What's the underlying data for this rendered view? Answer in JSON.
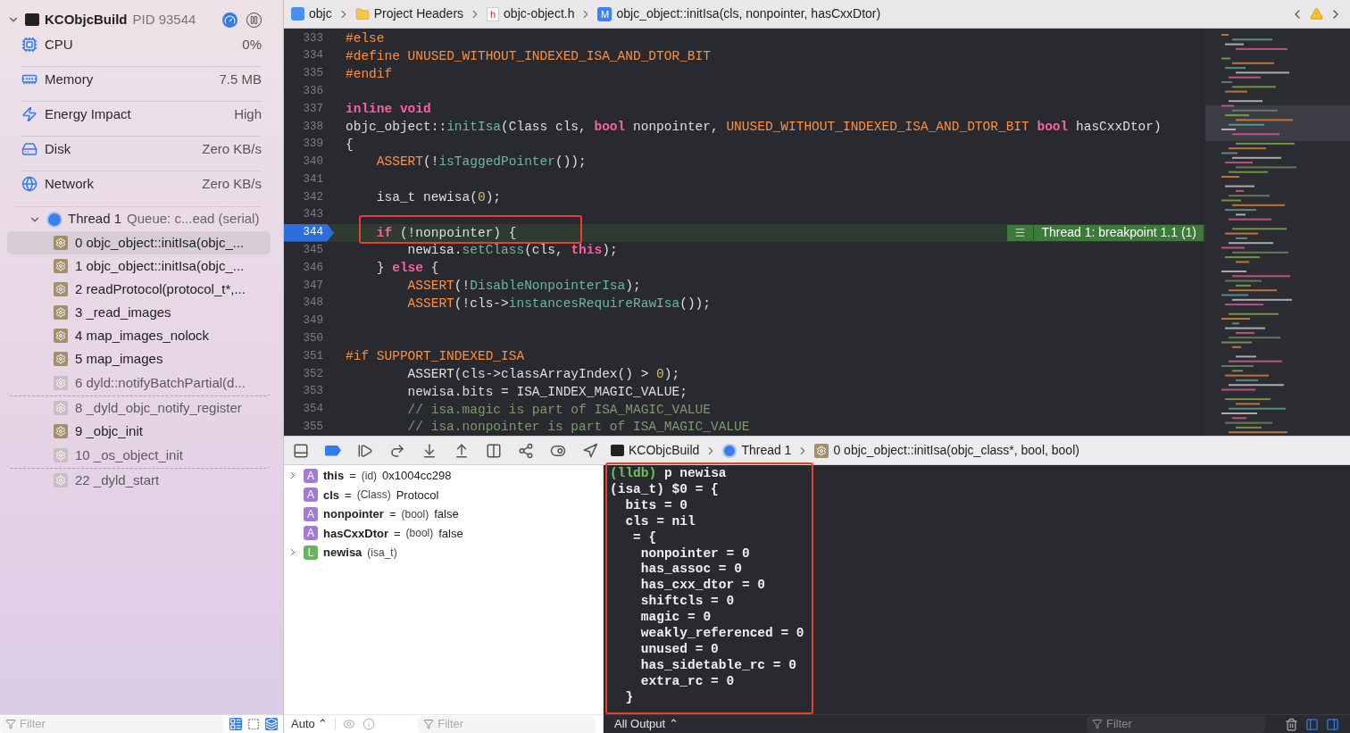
{
  "sidebar": {
    "process": {
      "name": "KCObjcBuild",
      "pid": "PID 93544"
    },
    "gauges": [
      {
        "kind": "cpu",
        "label": "CPU",
        "value": "0%"
      },
      {
        "kind": "memory",
        "label": "Memory",
        "value": "7.5 MB"
      },
      {
        "kind": "energy",
        "label": "Energy Impact",
        "value": "High"
      },
      {
        "kind": "disk",
        "label": "Disk",
        "value": "Zero KB/s"
      },
      {
        "kind": "network",
        "label": "Network",
        "value": "Zero KB/s"
      }
    ],
    "thread": {
      "label": "Thread 1",
      "queue": "Queue: c...ead (serial)",
      "expanded": true
    },
    "frames": [
      {
        "label": "0 objc_object::initIsa(objc_...",
        "selected": true,
        "dimmed": false,
        "gap_after": false
      },
      {
        "label": "1 objc_object::initIsa(objc_...",
        "selected": false,
        "dimmed": false,
        "gap_after": false
      },
      {
        "label": "2 readProtocol(protocol_t*,...",
        "selected": false,
        "dimmed": false,
        "gap_after": false
      },
      {
        "label": "3 _read_images",
        "selected": false,
        "dimmed": false,
        "gap_after": false
      },
      {
        "label": "4 map_images_nolock",
        "selected": false,
        "dimmed": false,
        "gap_after": false
      },
      {
        "label": "5 map_images",
        "selected": false,
        "dimmed": false,
        "gap_after": false
      },
      {
        "label": "6 dyld::notifyBatchPartial(d...",
        "selected": false,
        "dimmed": true,
        "gap_after": true
      },
      {
        "label": "8 _dyld_objc_notify_register",
        "selected": false,
        "dimmed": true,
        "gap_after": false
      },
      {
        "label": "9 _objc_init",
        "selected": false,
        "dimmed": false,
        "gap_after": false
      },
      {
        "label": "10 _os_object_init",
        "selected": false,
        "dimmed": true,
        "gap_after": true
      },
      {
        "label": "22 _dyld_start",
        "selected": false,
        "dimmed": true,
        "gap_after": false
      }
    ],
    "filter": {
      "placeholder": "Filter"
    }
  },
  "editor": {
    "breadcrumb": [
      {
        "kind": "project",
        "label": "objc"
      },
      {
        "kind": "folder",
        "label": "Project Headers"
      },
      {
        "kind": "header",
        "badge": "h",
        "label": "objc-object.h"
      },
      {
        "kind": "method",
        "badge": "M",
        "label": "objc_object::initIsa(cls, nonpointer, hasCxxDtor)"
      }
    ],
    "breakpoint_label": "Thread 1: breakpoint 1.1 (1)",
    "lines": [
      {
        "number": "333",
        "current": false,
        "tokens": [
          {
            "kind": "directive",
            "text": "#else"
          }
        ]
      },
      {
        "number": "334",
        "current": false,
        "tokens": [
          {
            "kind": "directive",
            "text": "#define"
          },
          {
            "kind": "macro",
            "text": " UNUSED_WITHOUT_INDEXED_ISA_AND_DTOR_BIT"
          }
        ]
      },
      {
        "number": "335",
        "current": false,
        "tokens": [
          {
            "kind": "directive",
            "text": "#endif"
          }
        ]
      },
      {
        "number": "336",
        "current": false
      },
      {
        "number": "337",
        "current": false,
        "tokens": [
          {
            "kind": "keyword",
            "text": "inline void"
          }
        ]
      },
      {
        "number": "338",
        "current": false,
        "tokens": [
          {
            "kind": "plain",
            "text": "objc_object::"
          },
          {
            "kind": "func",
            "text": "initIsa"
          },
          {
            "kind": "plain",
            "text": "(Class cls, "
          },
          {
            "kind": "keyword",
            "text": "bool"
          },
          {
            "kind": "plain",
            "text": " nonpointer, "
          },
          {
            "kind": "macro",
            "text": "UNUSED_WITHOUT_INDEXED_ISA_AND_DTOR_BIT"
          },
          {
            "kind": "keyword",
            "text": " bool"
          },
          {
            "kind": "plain",
            "text": " hasCxxDtor)"
          }
        ]
      },
      {
        "number": "339",
        "current": false,
        "tokens": [
          {
            "kind": "plain",
            "text": "{"
          }
        ]
      },
      {
        "number": "340",
        "current": false,
        "tokens": [
          {
            "kind": "macro",
            "text": "    ASSERT"
          },
          {
            "kind": "plain",
            "text": "(!"
          },
          {
            "kind": "func",
            "text": "isTaggedPointer"
          },
          {
            "kind": "plain",
            "text": "());"
          }
        ]
      },
      {
        "number": "341",
        "current": false
      },
      {
        "number": "342",
        "current": false,
        "tokens": [
          {
            "kind": "plain",
            "text": "    isa_t newisa("
          },
          {
            "kind": "number",
            "text": "0"
          },
          {
            "kind": "plain",
            "text": ");"
          }
        ]
      },
      {
        "number": "343",
        "current": false
      },
      {
        "number": "344",
        "current": true,
        "tokens": [
          {
            "kind": "keyword",
            "text": "    if"
          },
          {
            "kind": "plain",
            "text": " (!nonpointer) {"
          }
        ]
      },
      {
        "number": "345",
        "current": false,
        "tokens": [
          {
            "kind": "plain",
            "text": "        newisa."
          },
          {
            "kind": "func",
            "text": "setClass"
          },
          {
            "kind": "plain",
            "text": "(cls, "
          },
          {
            "kind": "keyword",
            "text": "this"
          },
          {
            "kind": "plain",
            "text": ");"
          }
        ]
      },
      {
        "number": "346",
        "current": false,
        "tokens": [
          {
            "kind": "plain",
            "text": "    } "
          },
          {
            "kind": "keyword",
            "text": "else"
          },
          {
            "kind": "plain",
            "text": " {"
          }
        ]
      },
      {
        "number": "347",
        "current": false,
        "tokens": [
          {
            "kind": "macro",
            "text": "        ASSERT"
          },
          {
            "kind": "plain",
            "text": "(!"
          },
          {
            "kind": "func",
            "text": "DisableNonpointerIsa"
          },
          {
            "kind": "plain",
            "text": ");"
          }
        ]
      },
      {
        "number": "348",
        "current": false,
        "tokens": [
          {
            "kind": "macro",
            "text": "        ASSERT"
          },
          {
            "kind": "plain",
            "text": "(!cls->"
          },
          {
            "kind": "func",
            "text": "instancesRequireRawIsa"
          },
          {
            "kind": "plain",
            "text": "());"
          }
        ]
      },
      {
        "number": "349",
        "current": false
      },
      {
        "number": "350",
        "current": false
      },
      {
        "number": "351",
        "current": false,
        "tokens": [
          {
            "kind": "directive",
            "text": "#if"
          },
          {
            "kind": "macro",
            "text": " SUPPORT_INDEXED_ISA"
          }
        ]
      },
      {
        "number": "352",
        "current": false,
        "tokens": [
          {
            "kind": "plain",
            "text": "        ASSERT(cls->classArrayIndex() > "
          },
          {
            "kind": "number",
            "text": "0"
          },
          {
            "kind": "plain",
            "text": ");"
          }
        ]
      },
      {
        "number": "353",
        "current": false,
        "tokens": [
          {
            "kind": "plain",
            "text": "        newisa.bits = ISA_INDEX_MAGIC_VALUE;"
          }
        ]
      },
      {
        "number": "354",
        "current": false,
        "tokens": [
          {
            "kind": "comment",
            "text": "        // isa.magic is part of ISA_MAGIC_VALUE"
          }
        ]
      },
      {
        "number": "355",
        "current": false,
        "tokens": [
          {
            "kind": "comment",
            "text": "        // isa.nonpointer is part of ISA_MAGIC_VALUE"
          }
        ]
      }
    ]
  },
  "debug_bar": {
    "breadcrumb": [
      {
        "kind": "process",
        "label": "KCObjcBuild"
      },
      {
        "kind": "thread",
        "label": "Thread 1"
      },
      {
        "kind": "frame",
        "label": "0 objc_object::initIsa(objc_class*, bool, bool)"
      }
    ]
  },
  "variables": [
    {
      "kind": "argument",
      "badge": "A",
      "name": "this",
      "equals": "=",
      "type": "(id)",
      "value": "0x1004cc298",
      "expandable": true
    },
    {
      "kind": "argument",
      "badge": "A",
      "name": "cls",
      "equals": "=",
      "type": "(Class)",
      "value": "Protocol",
      "expandable": false
    },
    {
      "kind": "argument",
      "badge": "A",
      "name": "nonpointer",
      "equals": "=",
      "type": "(bool)",
      "value": "false",
      "expandable": false
    },
    {
      "kind": "argument",
      "badge": "A",
      "name": "hasCxxDtor",
      "equals": "=",
      "type": "(bool)",
      "value": "false",
      "expandable": false
    },
    {
      "kind": "local",
      "badge": "L",
      "name": "newisa",
      "type": "(isa_t)",
      "expandable": true
    }
  ],
  "variables_footer": {
    "scope": "Auto ⌃",
    "filter_placeholder": "Filter"
  },
  "console": {
    "prompt": "(lldb)",
    "command": "p newisa",
    "output": [
      "(isa_t) $0 = {",
      "  bits = 0",
      "  cls = nil",
      "   = {",
      "    nonpointer = 0",
      "    has_assoc = 0",
      "    has_cxx_dtor = 0",
      "    shiftcls = 0",
      "    magic = 0",
      "    weakly_referenced = 0",
      "    unused = 0",
      "    has_sidetable_rc = 0",
      "    extra_rc = 0",
      "  }"
    ],
    "output_menu": "All Output ⌃",
    "filter_placeholder": "Filter"
  }
}
